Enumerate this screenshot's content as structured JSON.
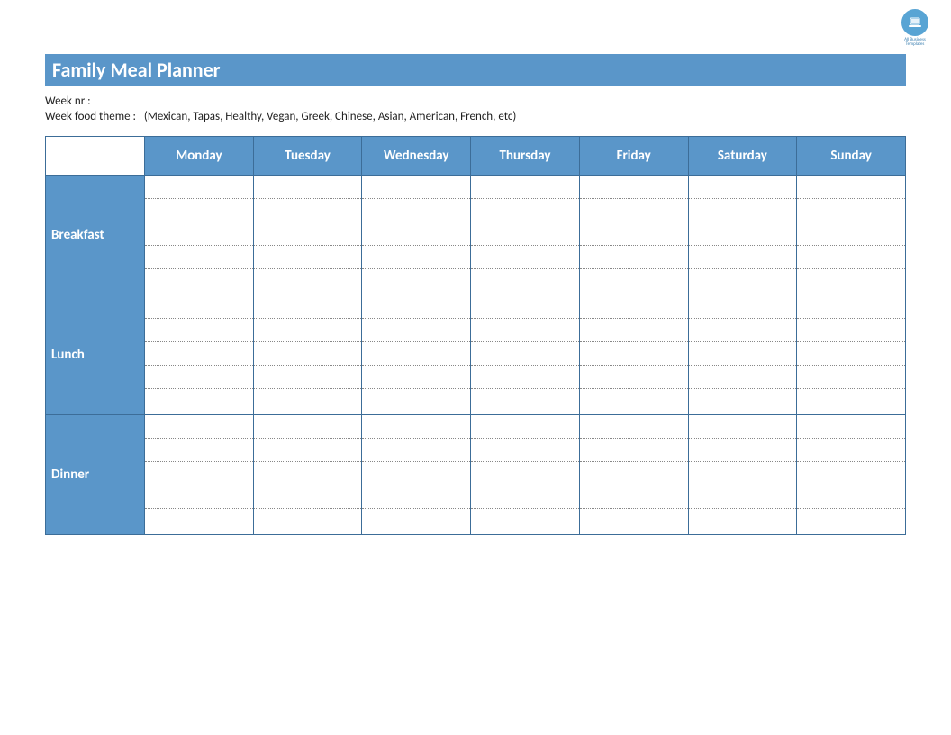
{
  "logo": {
    "line1": "All Business",
    "line2": "Templates"
  },
  "title": "Family Meal Planner",
  "meta": {
    "week_nr_label": "Week nr :",
    "theme_label": "Week food theme :",
    "theme_hint": "(Mexican, Tapas, Healthy, Vegan, Greek, Chinese, Asian, American, French, etc)"
  },
  "days": [
    "Monday",
    "Tuesday",
    "Wednesday",
    "Thursday",
    "Friday",
    "Saturday",
    "Sunday"
  ],
  "meals": [
    "Breakfast",
    "Lunch",
    "Dinner"
  ],
  "lines_per_slot": 5
}
